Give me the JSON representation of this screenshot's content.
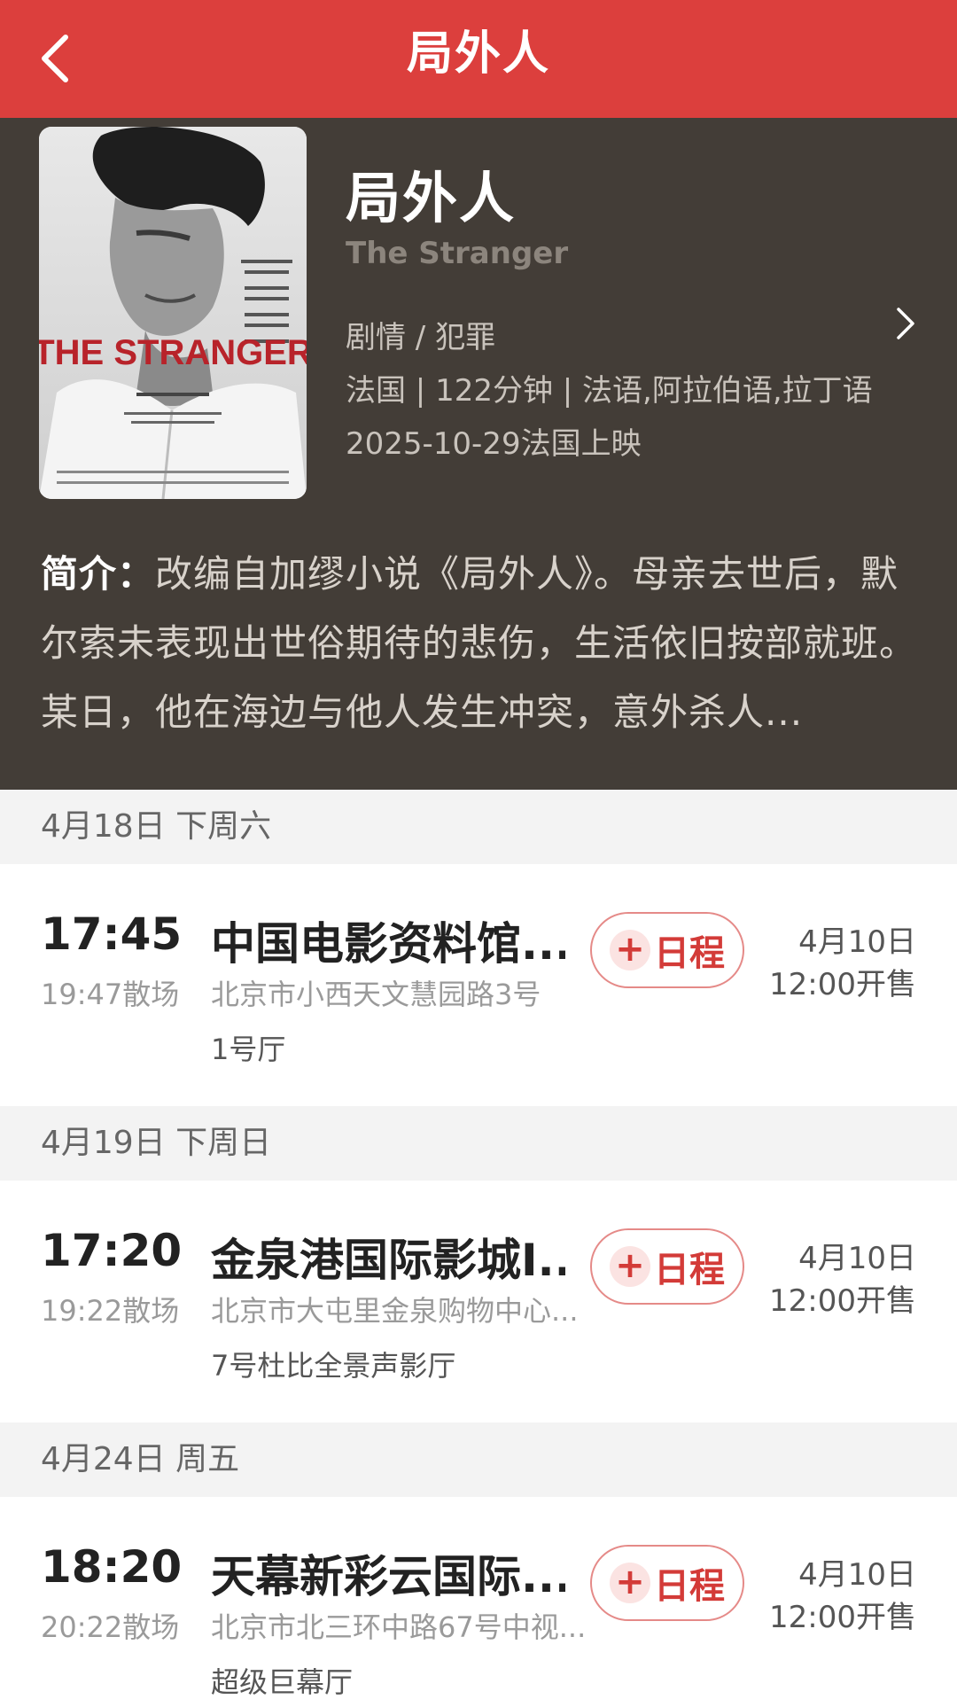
{
  "header": {
    "title": "局外人",
    "back_icon": "chevron-left-icon"
  },
  "movie": {
    "title": "局外人",
    "english_title": "The Stranger",
    "genre": "剧情 / 犯罪",
    "info": "法国 | 122分钟 | 法语,阿拉伯语,拉丁语",
    "release": "2025-10-29法国上映",
    "poster_text": "THE STRANGER",
    "synopsis_label": "简介：",
    "synopsis_text": "改编自加缪小说《局外人》。母亲去世后，默尔索未表现出世俗期待的悲伤，生活依旧按部就班。某日，他在海边与他人发生冲突，意外杀人..."
  },
  "showtimes": [
    {
      "date": "4月18日 下周六",
      "time": "17:45",
      "end": "19:47散场",
      "cinema": "中国电影资料馆...",
      "address": "北京市小西天文慧园路3号",
      "hall": "1号厅",
      "button": "日程",
      "sale_date": "4月10日",
      "sale_time": "12:00开售"
    },
    {
      "date": "4月19日 下周日",
      "time": "17:20",
      "end": "19:22散场",
      "cinema": "金泉港国际影城I...",
      "address": "北京市大屯里金泉购物中心...",
      "hall": "7号杜比全景声影厅",
      "button": "日程",
      "sale_date": "4月10日",
      "sale_time": "12:00开售"
    },
    {
      "date": "4月24日 周五",
      "time": "18:20",
      "end": "20:22散场",
      "cinema": "天幕新彩云国际...",
      "address": "北京市北三环中路67号中视...",
      "hall": "超级巨幕厅",
      "button": "日程",
      "sale_date": "4月10日",
      "sale_time": "12:00开售"
    }
  ],
  "colors": {
    "header_bg": "#dc3f3d",
    "hero_bg": "#433d37",
    "accent": "#d33b38",
    "date_bar_bg": "#f3f3f3"
  }
}
